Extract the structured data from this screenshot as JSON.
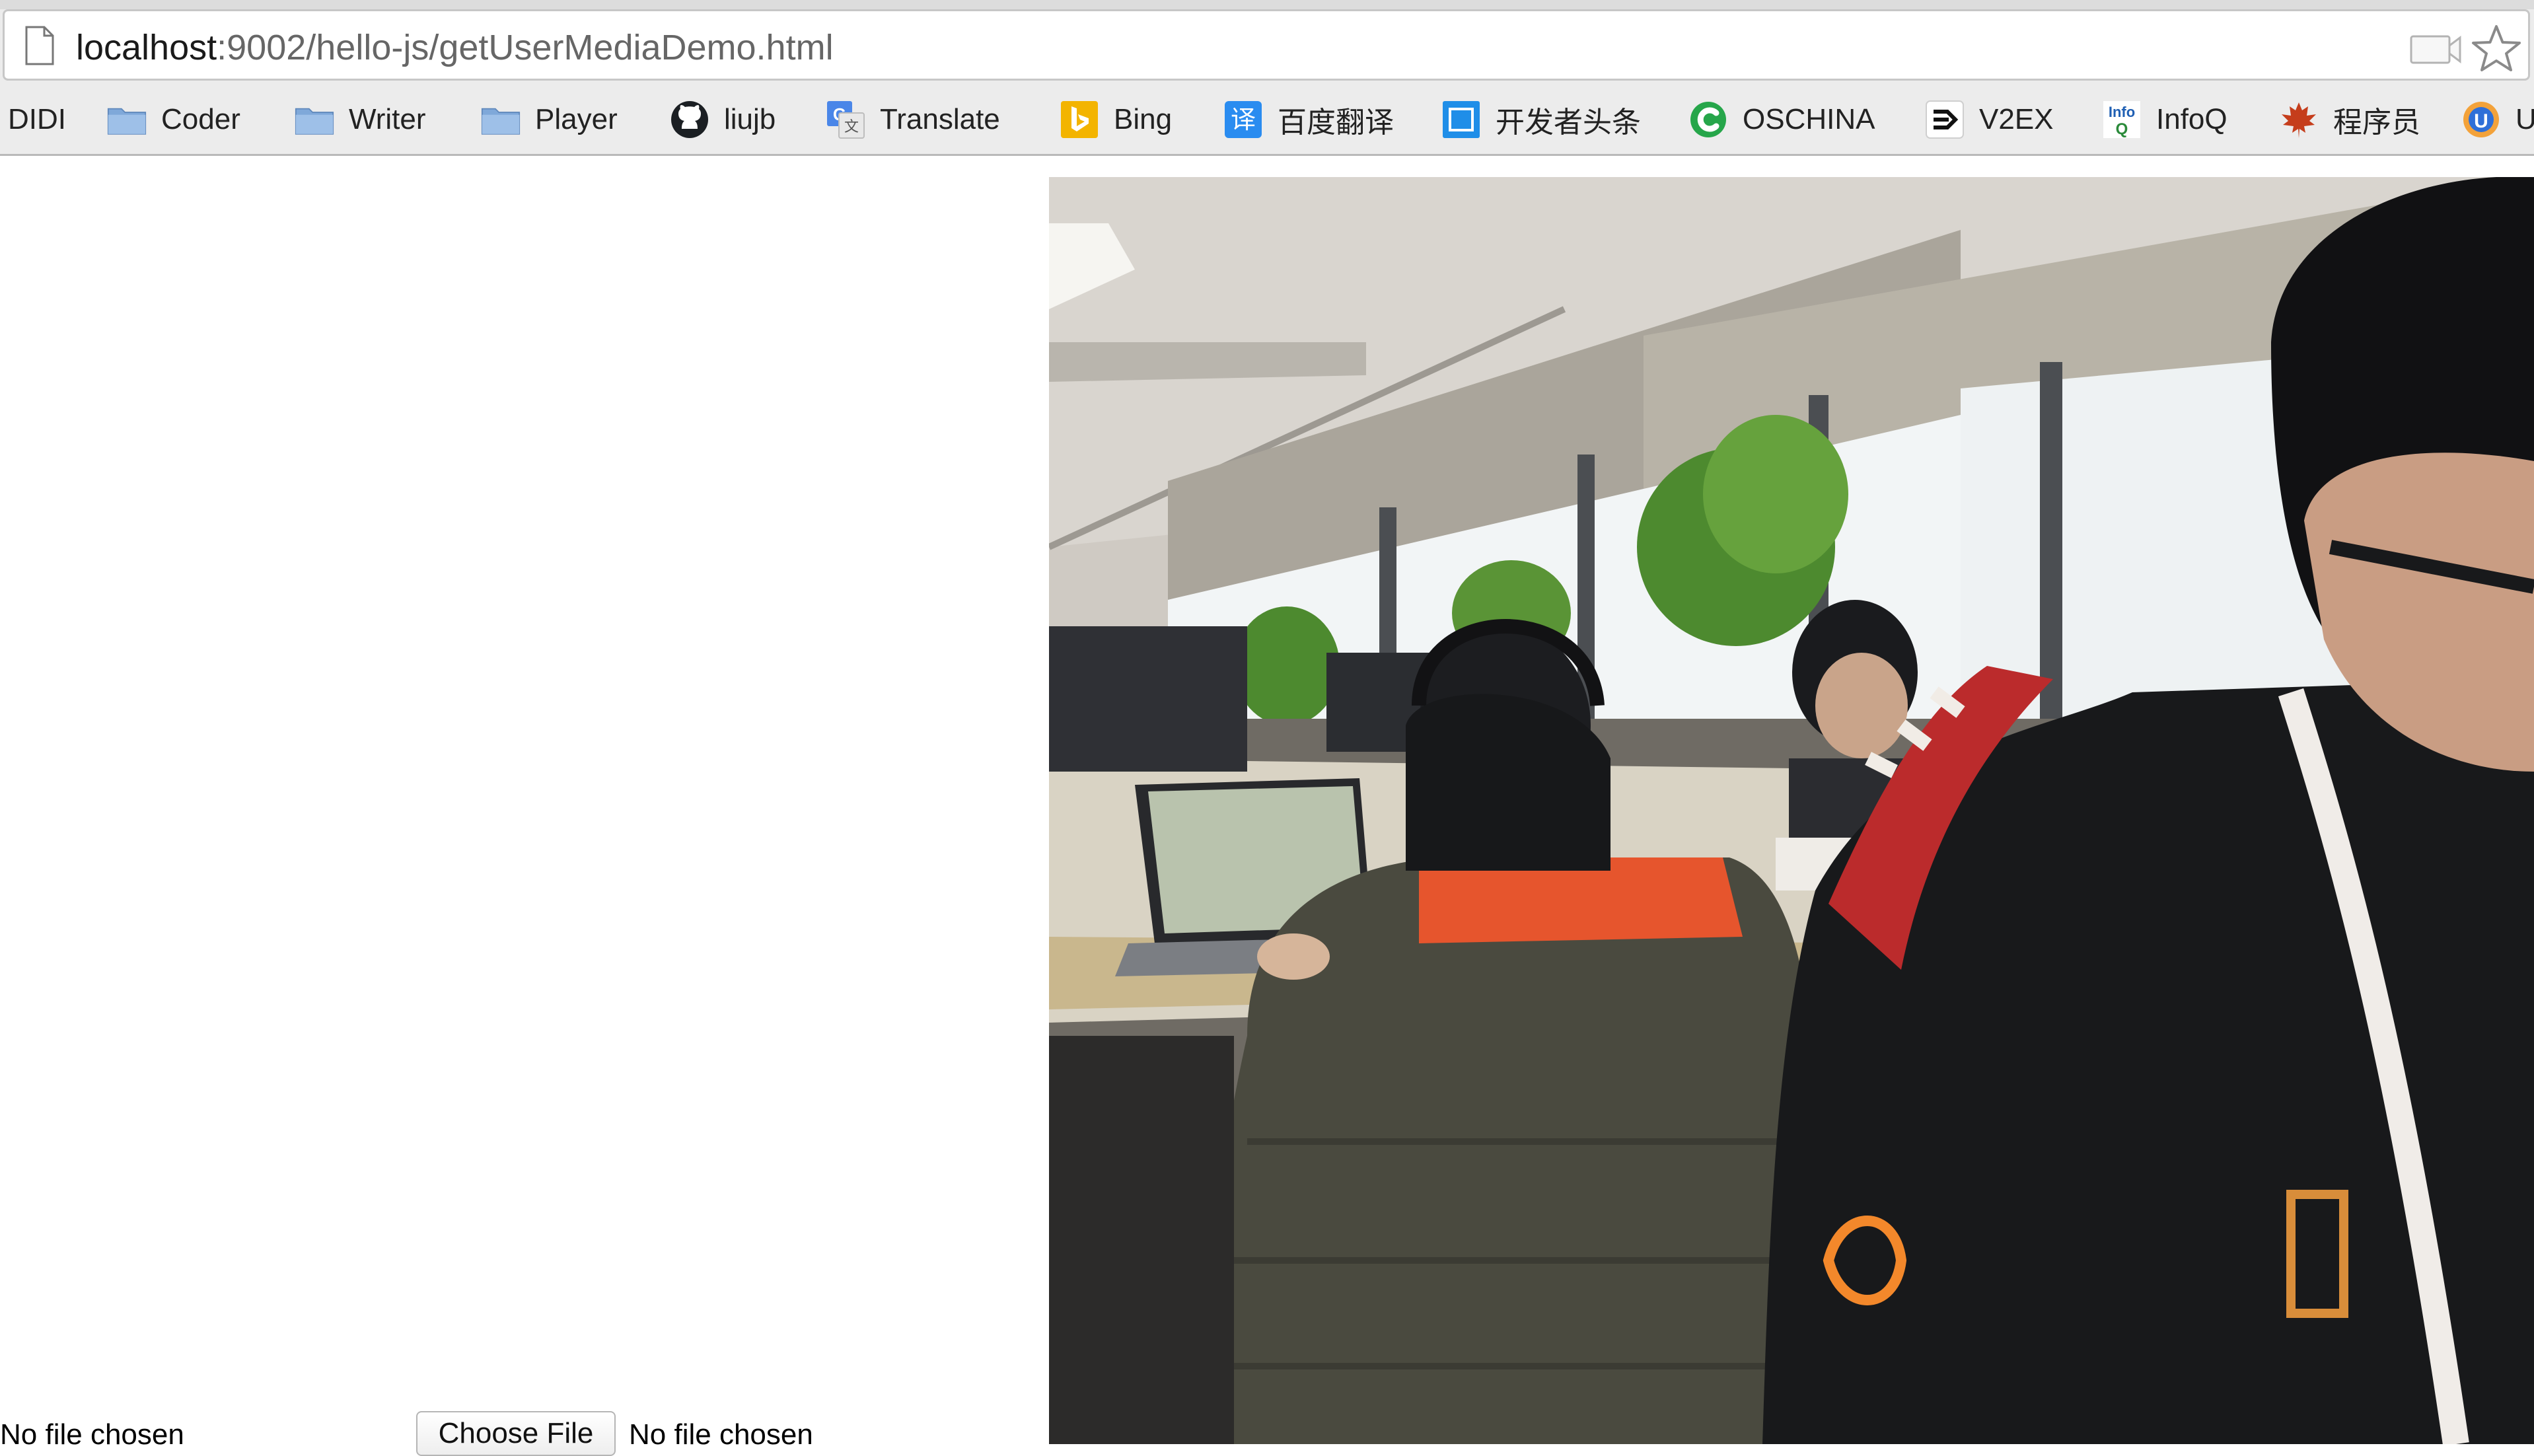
{
  "browser": {
    "url_host": "localhost",
    "url_path": ":9002/hello-js/getUserMediaDemo.html",
    "page_icon": "document-icon",
    "cast_icon": "cast-icon",
    "bookmark_icon": "star-icon"
  },
  "bookmarks": [
    {
      "label": "DIDI",
      "icon": "none"
    },
    {
      "label": "Coder",
      "icon": "folder-icon"
    },
    {
      "label": "Writer",
      "icon": "folder-icon"
    },
    {
      "label": "Player",
      "icon": "folder-icon"
    },
    {
      "label": "liujb",
      "icon": "github-icon"
    },
    {
      "label": "Translate",
      "icon": "google-translate-icon"
    },
    {
      "label": "Bing",
      "icon": "bing-icon"
    },
    {
      "label": "百度翻译",
      "icon": "baidu-translate-icon"
    },
    {
      "label": "开发者头条",
      "icon": "toutiao-icon"
    },
    {
      "label": "OSCHINA",
      "icon": "oschina-icon"
    },
    {
      "label": "V2EX",
      "icon": "v2ex-icon"
    },
    {
      "label": "InfoQ",
      "icon": "infoq-icon"
    },
    {
      "label": "程序员",
      "icon": "maple-leaf-icon"
    },
    {
      "label": "U",
      "icon": "u-icon"
    }
  ],
  "page": {
    "left_status": "No file chosen",
    "file_button_label": "Choose File",
    "file_status": "No file chosen",
    "video_frame": "webcam-video-frame"
  },
  "colors": {
    "chrome_bg": "#ececec",
    "folder_blue": "#7fa8d9",
    "google_blue": "#4a86e8",
    "bing_yellow": "#f3b400",
    "baidu_blue": "#2a8cf0",
    "toutiao_blue": "#1f8ee8",
    "oschina_green": "#26a64a",
    "maple_red": "#c53d1b"
  }
}
